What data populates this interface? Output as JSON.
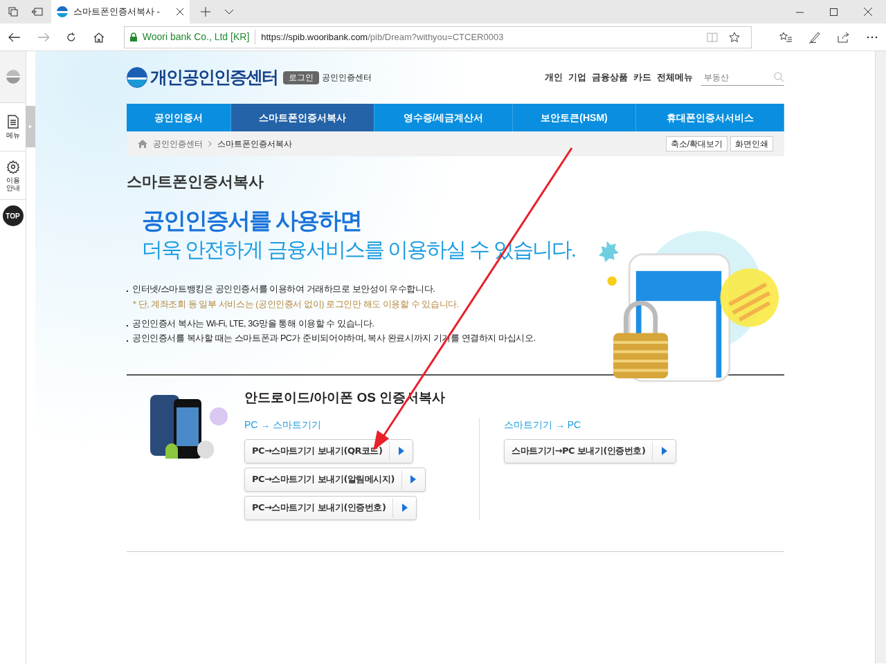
{
  "browser": {
    "tab_title": "스마트폰인증서복사 -",
    "site_identity": "Woori bank Co., Ltd [KR]",
    "url_host": "https://spib.wooribank.com",
    "url_path": "/pib/Dream?withyou=CTCER0003"
  },
  "side_panel": {
    "items": [
      {
        "kind": "menu",
        "label": "메뉴"
      },
      {
        "kind": "guide",
        "label": "이용 안내"
      }
    ],
    "top_button": "TOP"
  },
  "header": {
    "logo_text": "개인공인인증센터",
    "login_button": "로그인",
    "center_label": "공인인증센터",
    "top_links": [
      "개인",
      "기업",
      "금융상품",
      "카드",
      "전체메뉴"
    ],
    "search": {
      "placeholder": "부동산"
    }
  },
  "nav_tabs": [
    {
      "label": "공인인증서",
      "selected": false
    },
    {
      "label": "스마트폰인증서복사",
      "selected": true
    },
    {
      "label": "영수증/세금계산서",
      "selected": false
    },
    {
      "label": "보안토큰(HSM)",
      "selected": false
    },
    {
      "label": "휴대폰인증서서비스",
      "selected": false
    }
  ],
  "breadcrumb": {
    "items": [
      "공인인증센터",
      "스마트폰인증서복사"
    ],
    "tools": [
      "축소/확대보기",
      "화면인쇄"
    ]
  },
  "page_title": "스마트폰인증서복사",
  "banner": {
    "headline": "공인인증서를 사용하면",
    "subheadline": "더욱 안전하게 금융서비스를 이용하실 수 있습니다."
  },
  "notes": [
    {
      "kind": "bullet",
      "text": "인터넷/스마트뱅킹은 공인인증서를 이용하여 거래하므로 보안성이 우수합니다."
    },
    {
      "kind": "note",
      "text": "* 단, 계좌조회 등 일부 서비스는 (공인인증서 없이) 로그인만 해도 이용할 수 있습니다."
    },
    {
      "kind": "bullet",
      "text": "공인인증서 복사는 Wi-Fi, LTE, 3G망을 통해 이용할 수 있습니다."
    },
    {
      "kind": "bullet",
      "text": "공인인증서를 복사할 때는 스마트폰과 PC가 준비되어야하며, 복사 완료시까지 기기를 연결하지 마십시오."
    }
  ],
  "copy_section": {
    "title": "안드로이드/아이폰 OS 인증서복사",
    "groups": [
      {
        "heading": "PC → 스마트기기",
        "buttons": [
          "PC→스마트기기 보내기(QR코드)",
          "PC→스마트기기 보내기(알림메시지)",
          "PC→스마트기기 보내기(인증번호)"
        ]
      },
      {
        "heading": "스마트기기 → PC",
        "buttons": [
          "스마트기기→PC 보내기(인증번호)"
        ]
      }
    ]
  }
}
